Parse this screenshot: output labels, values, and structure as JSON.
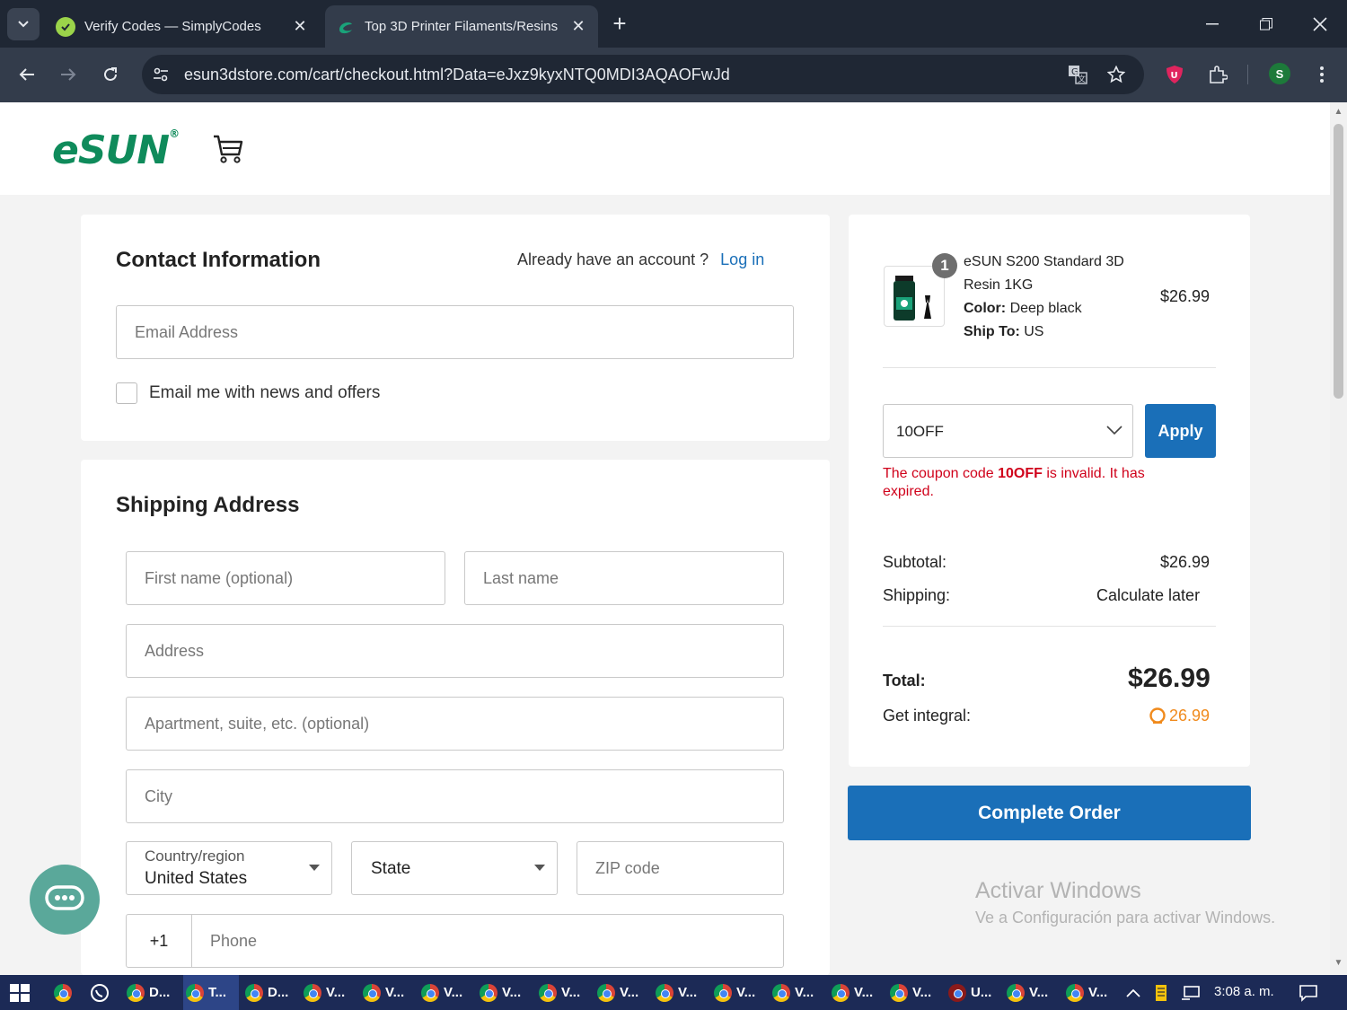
{
  "browser": {
    "tabs": [
      {
        "title": "Verify Codes — SimplyCodes",
        "active": false
      },
      {
        "title": "Top 3D Printer Filaments/Resins",
        "active": true
      }
    ],
    "url": "esun3dstore.com/cart/checkout.html?Data=eJxz9kyxNTQ0MDI3AQAOFwJd",
    "profile_initial": "S"
  },
  "header": {
    "logo_text": "eSUN",
    "logo_reg": "®"
  },
  "contact": {
    "title": "Contact Information",
    "account_prompt": "Already have an account ?",
    "login_link": "Log in",
    "email_placeholder": "Email Address",
    "newsletter_label": "Email me with news and offers"
  },
  "shipping": {
    "title": "Shipping Address",
    "first_name_placeholder": "First name (optional)",
    "last_name_placeholder": "Last name",
    "address_placeholder": "Address",
    "apartment_placeholder": "Apartment, suite, etc. (optional)",
    "city_placeholder": "City",
    "country_label": "Country/region",
    "country_value": "United States",
    "state_value": "State",
    "zip_placeholder": "ZIP code",
    "phone_prefix": "+1",
    "phone_placeholder": "Phone"
  },
  "order": {
    "item": {
      "quantity": "1",
      "name": "eSUN S200 Standard 3D Resin 1KG",
      "color_label": "Color:",
      "color_value": "Deep black",
      "ship_label": "Ship To:",
      "ship_value": "US",
      "price": "$26.99"
    },
    "coupon_value": "10OFF",
    "apply_label": "Apply",
    "coupon_error_pre": "The coupon code ",
    "coupon_error_code": "10OFF",
    "coupon_error_post": " is invalid. It has expired.",
    "subtotal_label": "Subtotal:",
    "subtotal_value": "$26.99",
    "shipping_label": "Shipping:",
    "shipping_value": "Calculate later",
    "total_label": "Total:",
    "total_value": "$26.99",
    "integral_label": "Get integral:",
    "integral_value": "26.99",
    "complete_label": "Complete Order"
  },
  "watermark": {
    "line1": "Activar Windows",
    "line2": "Ve a Configuración para activar Windows."
  },
  "taskbar": {
    "items": [
      "D...",
      "T...",
      "D...",
      "V...",
      "V...",
      "V...",
      "V...",
      "V...",
      "V...",
      "V...",
      "V...",
      "V...",
      "V...",
      "V...",
      "U...",
      "V...",
      "V..."
    ],
    "clock": "3:08 a. m."
  },
  "colors": {
    "accent": "#1a6fb8",
    "brand": "#0f8b5b",
    "error": "#d0021b",
    "integral": "#f08a1c"
  }
}
